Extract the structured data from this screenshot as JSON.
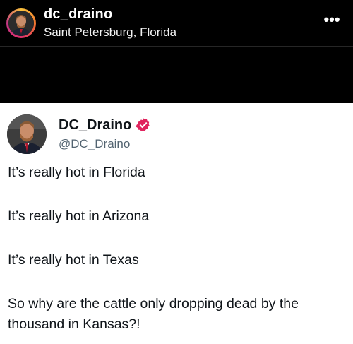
{
  "post_header": {
    "username": "dc_draino",
    "location": "Saint Petersburg, Florida",
    "more_icon": "more-options-icon",
    "more_glyph": "•••"
  },
  "tweet": {
    "display_name": "DC_Draino",
    "handle": "@DC_Draino",
    "verified": true,
    "verified_color": "#e0245e",
    "lines": [
      "It’s really hot in Florida",
      "It’s really hot in Arizona",
      "It’s really hot in Texas",
      "So why are the cattle only dropping dead by the thousand in Kansas?!"
    ]
  }
}
